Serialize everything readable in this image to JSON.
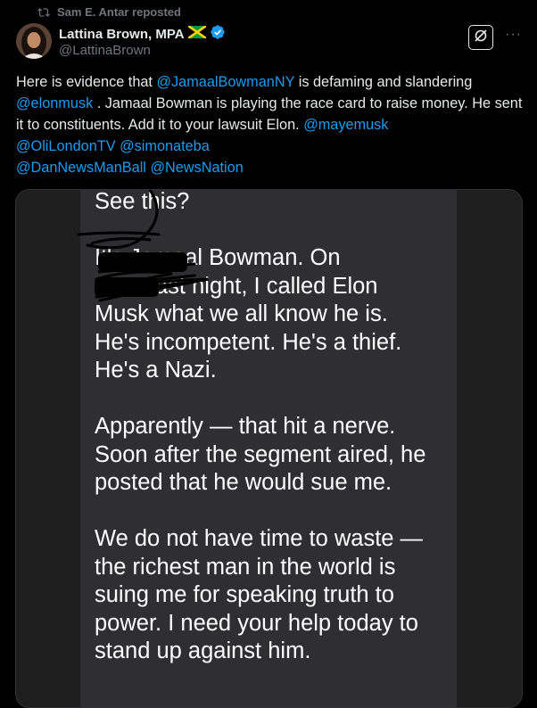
{
  "repost": {
    "icon": "repost-icon",
    "text": "Sam E. Antar reposted"
  },
  "author": {
    "name": "Lattina Brown, MPA",
    "flag_icon": "jamaica-flag-icon",
    "verified_icon": "verified-badge-icon",
    "handle": "@LattinaBrown",
    "verified_color": "#1d9bf0"
  },
  "header_actions": {
    "grok_icon": "grok-icon",
    "more_label": "···"
  },
  "tweet": {
    "segments": [
      {
        "text": "Here is evidence that ",
        "type": "text"
      },
      {
        "text": "@JamaalBowmanNY",
        "type": "mention"
      },
      {
        "text": " is defaming and slandering ",
        "type": "text"
      },
      {
        "text": "@elonmusk",
        "type": "mention"
      },
      {
        "text": " . Jamaal Bowman is playing the race card to raise money. He sent it to constituents. Add it to your lawsuit Elon. ",
        "type": "text"
      },
      {
        "text": "@mayemusk",
        "type": "mention"
      },
      {
        "text": " ",
        "type": "text"
      },
      {
        "text": "@OliLondonTV",
        "type": "mention"
      },
      {
        "text": " ",
        "type": "text"
      },
      {
        "text": "@simonateba",
        "type": "mention"
      },
      {
        "text": " ",
        "type": "text"
      },
      {
        "text": "@DanNewsManBall",
        "type": "mention"
      },
      {
        "text": " ",
        "type": "text"
      },
      {
        "text": "@NewsNation",
        "type": "mention"
      }
    ],
    "mention_color": "#1d9bf0"
  },
  "media": {
    "message": "See this?\n\nIt's Jamaal Bowman. On\nCNN last night, I called Elon\nMusk what we all know he is.\nHe's incompetent. He's a thief.\nHe's a Nazi.\n\nApparently — that hit a nerve.\nSoon after the segment aired, he\nposted that he would sue me.\n\nWe do not have time to waste —\nthe richest man in the world is\nsuing me for speaking truth to\npower. I need your help today to\nstand up against him."
  }
}
